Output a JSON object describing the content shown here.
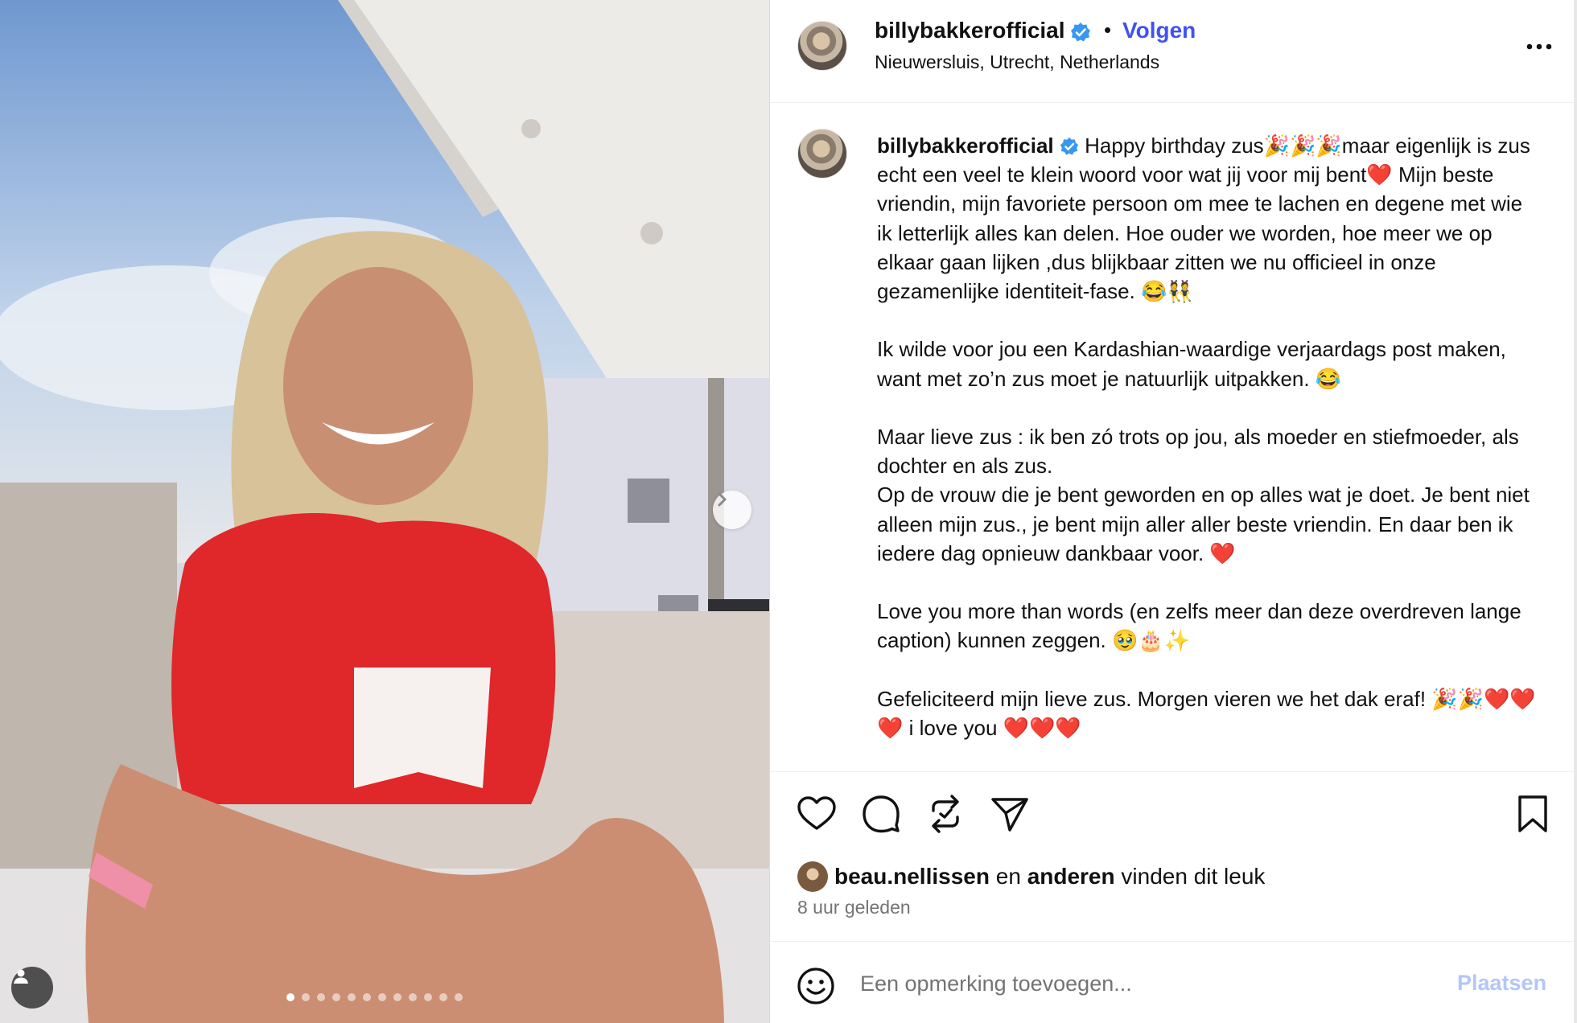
{
  "post": {
    "username": "billybakkerofficial",
    "location": "Nieuwersluis, Utrecht, Netherlands",
    "follow_label": "Volgen",
    "header_dot": "•",
    "caption": "Happy birthday zus🎉🎉🎉maar eigenlijk is zus echt een veel te klein woord voor wat jij voor mij bent❤️ Mijn beste vriendin, mijn favoriete persoon om mee te lachen en degene met wie ik letterlijk alles kan delen. Hoe ouder we worden, hoe meer we op elkaar gaan lijken ,dus blijkbaar zitten we nu officieel in onze gezamenlijke identiteit-fase. 😂👯\n\nIk wilde voor jou een Kardashian-waardige verjaardags post maken, want met zo’n zus moet je natuurlijk uitpakken. 😂\n\nMaar lieve zus : ik ben zó trots op jou, als moeder en stiefmoeder, als dochter en als zus.\nOp de vrouw die je bent geworden en op alles wat je doet. Je bent niet alleen mijn zus., je bent mijn aller aller beste vriendin. En daar ben ik iedere dag opnieuw dankbaar voor. ❤️\n\nLove you more than words (en zelfs meer dan deze overdreven lange caption) kunnen zeggen. 🥹🎂✨\n\nGefeliciteerd mijn lieve zus. Morgen vieren we het dak eraf! 🎉🎉❤️❤️❤️ i love you ❤️❤️❤️",
    "likes": {
      "first_user": "beau.nellissen",
      "connector": "en",
      "others": "anderen",
      "suffix": "vinden dit leuk"
    },
    "time_ago": "8 uur geleden",
    "carousel": {
      "count": 12,
      "active_index": 0
    }
  },
  "comment_box": {
    "placeholder": "Een opmerking toevoegen...",
    "post_label": "Plaatsen"
  },
  "icons": {
    "like": "heart-icon",
    "comment": "speech-bubble-icon",
    "repost": "repost-icon",
    "share": "paper-plane-icon",
    "save": "bookmark-icon",
    "more": "more-dots-icon",
    "emoji": "smiley-icon",
    "next": "chevron-right-icon",
    "tag": "user-tag-icon",
    "verified": "verified-badge-icon"
  },
  "colors": {
    "accent": "#4150f7",
    "verified": "#3897f0",
    "muted_text": "#737373",
    "post_button": "#b3c6f7"
  }
}
